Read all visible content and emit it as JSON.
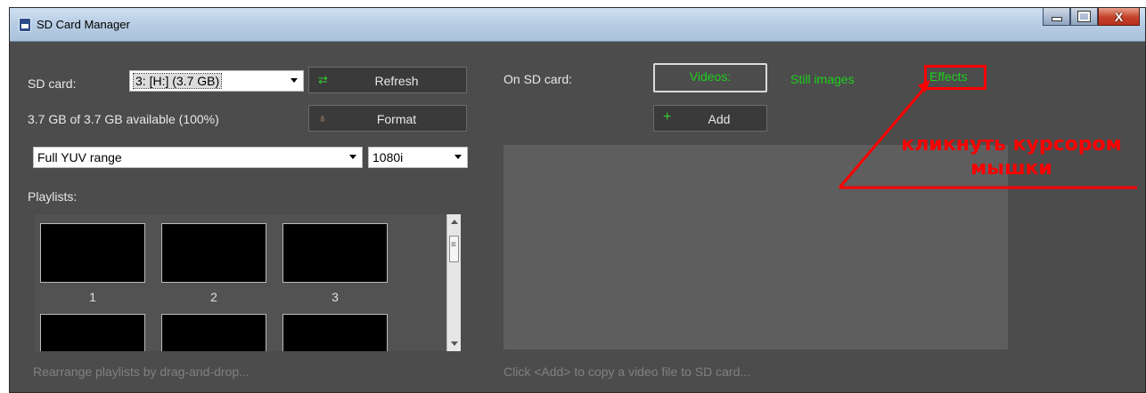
{
  "window": {
    "title": "SD Card Manager",
    "caption_buttons": {
      "minimize": "minimize",
      "maximize": "maximize",
      "close": "X"
    }
  },
  "left": {
    "sd_card_label": "SD card:",
    "sd_card_value": "3: [H:] (3.7 GB)",
    "refresh_label": "Refresh",
    "available_text": "3.7 GB of 3.7 GB available (100%)",
    "format_label": "Format",
    "yuv_value": "Full YUV range",
    "resolution_value": "1080i",
    "playlists_label": "Playlists:",
    "playlists": [
      {
        "label": "1"
      },
      {
        "label": "2"
      },
      {
        "label": "3"
      },
      {
        "label": ""
      },
      {
        "label": ""
      },
      {
        "label": ""
      }
    ],
    "hint": "Rearrange playlists by drag-and-drop..."
  },
  "right": {
    "on_sd_card_label": "On SD card:",
    "tabs": {
      "videos": "Videos:",
      "still_images": "Still images",
      "effects": "Effects"
    },
    "add_label": "Add",
    "hint": "Click <Add> to copy a video file to SD card..."
  },
  "annotation": {
    "line1": "кликнуть курсором",
    "line2": "мышки"
  },
  "colors": {
    "background": "#4c4c4c",
    "tab_text": "#1ccf1c",
    "annotation": "#ff0000",
    "refresh_icon": "#33cc33",
    "add_icon": "#33cc33"
  },
  "icons": {
    "refresh": "refresh-icon",
    "format": "format-icon",
    "add": "plus-icon",
    "app": "sd-card-app-icon"
  }
}
